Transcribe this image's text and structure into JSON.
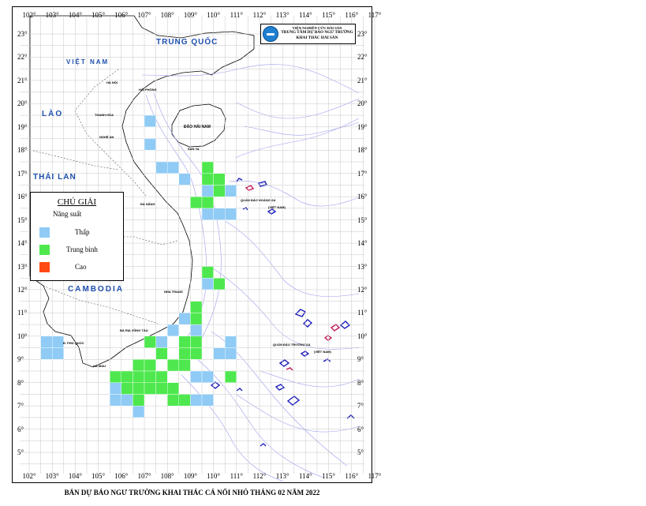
{
  "title": "BẢN DỰ BÁO NGƯ TRƯỜNG KHAI THÁC CÁ NỔI NHỎ THÁNG 02 NĂM 2022",
  "institute": {
    "parent": "VIỆN NGHIÊN CỨU HẢI SẢN",
    "name_line1": "TRUNG TÂM DỰ BÁO NGƯ TRƯỜNG",
    "name_line2": "KHAI THÁC HẢI SẢN"
  },
  "legend": {
    "title": "CHÚ GIẢI",
    "subtitle": "Năng suất",
    "items": [
      {
        "label": "Thấp",
        "color": "#8fcbf5"
      },
      {
        "label": "Trung bình",
        "color": "#4ee84e"
      },
      {
        "label": "Cao",
        "color": "#ff4a14"
      }
    ]
  },
  "x_ticks": [
    "102°",
    "103°",
    "104°",
    "105°",
    "106°",
    "107°",
    "108°",
    "109°",
    "110°",
    "111°",
    "112°",
    "113°",
    "114°",
    "115°",
    "116°",
    "117°"
  ],
  "y_ticks": [
    "23°",
    "22°",
    "21°",
    "20°",
    "19°",
    "18°",
    "17°",
    "16°",
    "15°",
    "14°",
    "13°",
    "12°",
    "11°",
    "10°",
    "9°",
    "8°",
    "7°",
    "6°",
    "5°"
  ],
  "country_labels": {
    "vietnam": "VIỆT NAM",
    "china": "TRUNG QUỐC",
    "laos": "LÀO",
    "thailand": "THÁI LAN",
    "cambodia": "CAMBODIA",
    "hainan": "ĐẢO HẢI NAM"
  },
  "city_labels": {
    "hanoi": "HÀ NỘI",
    "haiphong": "HẢI PHÒNG",
    "thanhhoa": "THANH HÓA",
    "nghean": "NGHỆ AN",
    "danang": "ĐÀ NẴNG",
    "nhatrang": "NHA TRANG",
    "vungtau": "BÀ RỊA VŨNG TÀU",
    "camau": "CÀ MAU",
    "phuquoc": "Đ. PHÚ QUỐC",
    "sanya": "SAN YA",
    "hoangsa": "QUẦN ĐẢO HOÀNG SA",
    "truongsa": "QUẦN ĐẢO TRƯỜNG SA",
    "vn_hs": "(VIỆT NAM)",
    "vn_ts": "(VIỆT NAM)"
  },
  "forecast_cells": {
    "low": [
      [
        107,
        19
      ],
      [
        107,
        18
      ],
      [
        107.5,
        17
      ],
      [
        108,
        17
      ],
      [
        108.5,
        16.5
      ],
      [
        109.5,
        16
      ],
      [
        109.5,
        15
      ],
      [
        110,
        15
      ],
      [
        110.5,
        15
      ],
      [
        110.5,
        16
      ],
      [
        109.5,
        12
      ],
      [
        108.5,
        10.5
      ],
      [
        109,
        10
      ],
      [
        108,
        10
      ],
      [
        107.5,
        9.5
      ],
      [
        110.5,
        9.5
      ],
      [
        110,
        9
      ],
      [
        110.5,
        9
      ],
      [
        102.5,
        9.5
      ],
      [
        103,
        9.5
      ],
      [
        102.5,
        9
      ],
      [
        103,
        9
      ],
      [
        105.5,
        7.5
      ],
      [
        105.5,
        7
      ],
      [
        106,
        7
      ],
      [
        106.5,
        6.5
      ],
      [
        109,
        7
      ],
      [
        109.5,
        7
      ],
      [
        109,
        8
      ],
      [
        109.5,
        8
      ]
    ],
    "medium": [
      [
        109.5,
        17
      ],
      [
        109.5,
        16.5
      ],
      [
        109,
        15.5
      ],
      [
        110,
        16
      ],
      [
        110,
        16.5
      ],
      [
        109.5,
        15.5
      ],
      [
        109.5,
        12.5
      ],
      [
        110,
        12
      ],
      [
        109,
        11
      ],
      [
        109,
        10.5
      ],
      [
        107,
        9.5
      ],
      [
        107.5,
        9
      ],
      [
        106.5,
        8.5
      ],
      [
        107,
        8.5
      ],
      [
        106,
        8
      ],
      [
        106.5,
        8
      ],
      [
        107,
        8
      ],
      [
        107.5,
        8
      ],
      [
        108,
        8.5
      ],
      [
        108.5,
        8.5
      ],
      [
        106,
        7.5
      ],
      [
        106.5,
        7.5
      ],
      [
        107,
        7.5
      ],
      [
        107.5,
        7.5
      ],
      [
        108,
        7.5
      ],
      [
        108.5,
        7
      ],
      [
        108,
        7
      ],
      [
        108.5,
        9
      ],
      [
        109,
        9.5
      ],
      [
        108.5,
        9.5
      ],
      [
        109,
        9
      ],
      [
        106.5,
        7
      ],
      [
        105.5,
        8
      ],
      [
        110.5,
        8
      ]
    ],
    "high": []
  }
}
